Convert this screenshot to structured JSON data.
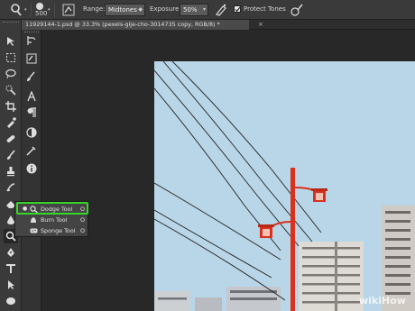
{
  "options_bar": {
    "brush_size": "500",
    "range_label": "Range:",
    "range_value": "Midtones",
    "exposure_label": "Exposure:",
    "exposure_value": "50%",
    "protect_tones_label": "Protect Tones",
    "protect_tones_checked": true
  },
  "document": {
    "tab_title": "11929144-1.psd @ 33.3% (pexels-gije-cho-3014735 copy, RGB/8) *",
    "close_label": "×"
  },
  "tool_flyout": {
    "items": [
      {
        "label": "Dodge Tool",
        "shortcut": "O",
        "icon": "dodge-icon",
        "selected": true
      },
      {
        "label": "Burn Tool",
        "shortcut": "O",
        "icon": "burn-icon",
        "selected": false
      },
      {
        "label": "Sponge Tool",
        "shortcut": "O",
        "icon": "sponge-icon",
        "selected": false
      }
    ]
  },
  "colors": {
    "highlight": "#37d629",
    "sky": "#b9d6e8",
    "lamp": "#d9311c"
  },
  "watermark": "wikiHow"
}
